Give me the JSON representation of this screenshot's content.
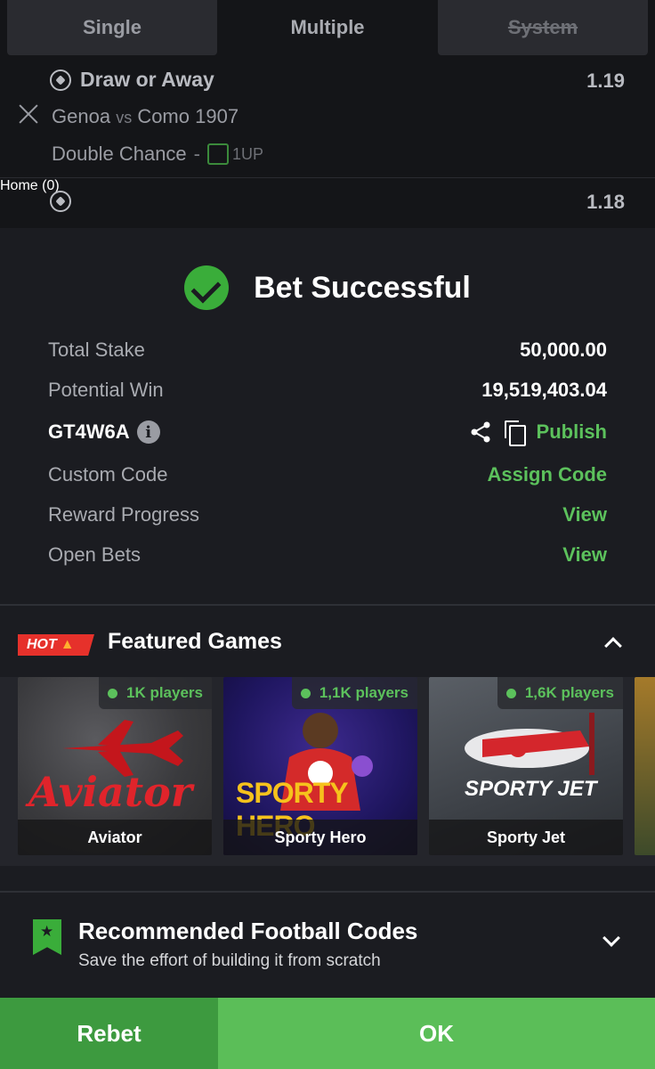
{
  "tabs": {
    "single": "Single",
    "multiple": "Multiple",
    "system": "System"
  },
  "selections": [
    {
      "title": "Draw or Away",
      "odds": "1.19",
      "home": "Genoa",
      "vs": "vs",
      "away": "Como 1907",
      "market": "Double Chance",
      "market_sep": "-",
      "tag": "1UP"
    },
    {
      "title": "Home (0)",
      "odds": "1.18"
    }
  ],
  "success": {
    "title": "Bet Successful",
    "total_stake_label": "Total Stake",
    "total_stake": "50,000.00",
    "potential_win_label": "Potential Win",
    "potential_win": "19,519,403.04",
    "booking_code": "GT4W6A",
    "info_glyph": "i",
    "publish_label": "Publish",
    "custom_code_label": "Custom Code",
    "assign_code_label": "Assign Code",
    "reward_progress_label": "Reward Progress",
    "reward_view_label": "View",
    "open_bets_label": "Open Bets",
    "open_bets_view_label": "View"
  },
  "featured": {
    "badge": "HOT",
    "title": "Featured Games",
    "games": [
      {
        "name": "Aviator",
        "players": "1K players",
        "art_text": "Aviator"
      },
      {
        "name": "Sporty Hero",
        "players": "1,1K players",
        "art_text": "SPORTY HERO"
      },
      {
        "name": "Sporty Jet",
        "players": "1,6K players",
        "art_text": "SPORTY JET"
      }
    ]
  },
  "recommended": {
    "title": "Recommended Football Codes",
    "subtitle": "Save the effort of building it from scratch"
  },
  "buttons": {
    "rebet": "Rebet",
    "ok": "OK"
  },
  "colors": {
    "accent_green": "#5cc15c",
    "hot_red": "#e6312b",
    "background": "#1b1c21"
  },
  "icons": [
    "soccer-ball-icon",
    "close-icon",
    "check-circle-icon",
    "info-icon",
    "share-icon",
    "copy-icon",
    "chevron-up-icon",
    "bookmark-star-icon",
    "chevron-down-icon",
    "fire-icon"
  ]
}
